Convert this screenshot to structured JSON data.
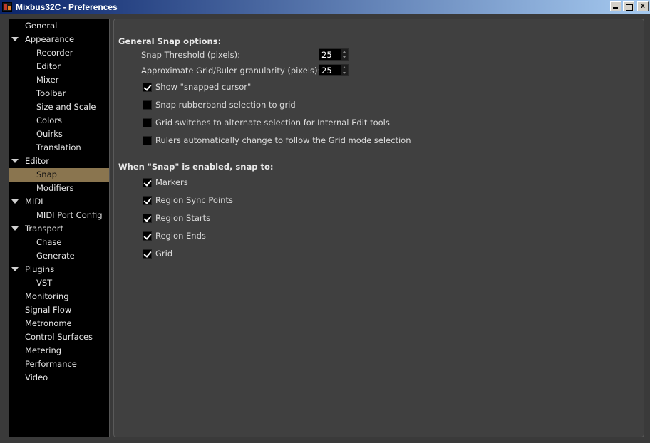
{
  "window": {
    "title": "Mixbus32C - Preferences",
    "close_glyph": "x"
  },
  "sidebar": {
    "items": [
      {
        "label": "General",
        "level": 0,
        "expander": false
      },
      {
        "label": "Appearance",
        "level": 0,
        "expander": true
      },
      {
        "label": "Recorder",
        "level": 1
      },
      {
        "label": "Editor",
        "level": 1
      },
      {
        "label": "Mixer",
        "level": 1
      },
      {
        "label": "Toolbar",
        "level": 1
      },
      {
        "label": "Size and Scale",
        "level": 1
      },
      {
        "label": "Colors",
        "level": 1
      },
      {
        "label": "Quirks",
        "level": 1
      },
      {
        "label": "Translation",
        "level": 1
      },
      {
        "label": "Editor",
        "level": 0,
        "expander": true
      },
      {
        "label": "Snap",
        "level": 1,
        "selected": true
      },
      {
        "label": "Modifiers",
        "level": 1
      },
      {
        "label": "MIDI",
        "level": 0,
        "expander": true
      },
      {
        "label": "MIDI Port Config",
        "level": 1
      },
      {
        "label": "Transport",
        "level": 0,
        "expander": true
      },
      {
        "label": "Chase",
        "level": 1
      },
      {
        "label": "Generate",
        "level": 1
      },
      {
        "label": "Plugins",
        "level": 0,
        "expander": true
      },
      {
        "label": "VST",
        "level": 1
      },
      {
        "label": "Monitoring",
        "level": 0
      },
      {
        "label": "Signal Flow",
        "level": 0
      },
      {
        "label": "Metronome",
        "level": 0
      },
      {
        "label": "Control Surfaces",
        "level": 0
      },
      {
        "label": "Metering",
        "level": 0
      },
      {
        "label": "Performance",
        "level": 0
      },
      {
        "label": "Video",
        "level": 0
      }
    ]
  },
  "general_snap": {
    "heading": "General Snap options:",
    "snap_threshold_label": "Snap Threshold (pixels):",
    "snap_threshold_value": "25",
    "granularity_label": "Approximate Grid/Ruler granularity (pixels):",
    "granularity_value": "25",
    "options": [
      {
        "label": "Show \"snapped cursor\"",
        "checked": true
      },
      {
        "label": "Snap rubberband selection to grid",
        "checked": false
      },
      {
        "label": "Grid switches to alternate selection for Internal Edit tools",
        "checked": false
      },
      {
        "label": "Rulers automatically change to follow the Grid mode selection",
        "checked": false
      }
    ]
  },
  "snap_to": {
    "heading": "When \"Snap\" is enabled, snap to:",
    "options": [
      {
        "label": "Markers",
        "checked": true
      },
      {
        "label": "Region Sync Points",
        "checked": true
      },
      {
        "label": "Region Starts",
        "checked": true
      },
      {
        "label": "Region Ends",
        "checked": true
      },
      {
        "label": "Grid",
        "checked": true
      }
    ]
  },
  "colors": {
    "selection": "#8a754f",
    "panel_bg": "#404040",
    "sidebar_bg": "#000000"
  }
}
